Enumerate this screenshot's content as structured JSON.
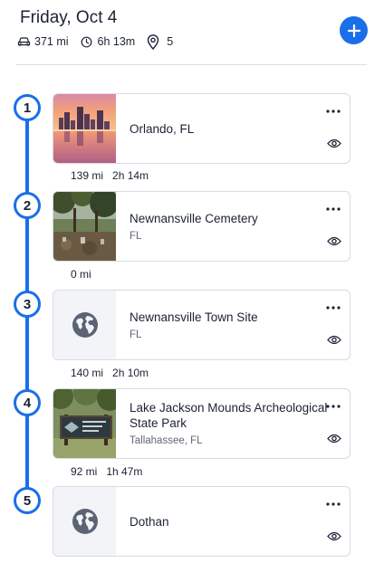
{
  "header": {
    "title": "Friday, Oct 4",
    "distance": "371 mi",
    "duration": "6h 13m",
    "stops_count": "5",
    "icons": {
      "distance": "car-icon",
      "duration": "clock-icon",
      "stops": "location-pin-icon",
      "add": "plus-icon"
    }
  },
  "colors": {
    "accent": "#1a6fe8",
    "text": "#1b2233",
    "muted": "#5f6675",
    "border": "#d7dbe1"
  },
  "stops": [
    {
      "number": "1",
      "name": "Orlando, FL",
      "subtitle": "",
      "thumbnail": "photo-city-skyline-sunset"
    },
    {
      "number": "2",
      "name": "Newnansville Cemetery",
      "subtitle": "FL",
      "thumbnail": "photo-cemetery-trees"
    },
    {
      "number": "3",
      "name": "Newnansville Town Site",
      "subtitle": "FL",
      "thumbnail": "globe-icon"
    },
    {
      "number": "4",
      "name": "Lake Jackson Mounds Archeological State Park",
      "subtitle": "Tallahassee, FL",
      "thumbnail": "photo-park-sign"
    },
    {
      "number": "5",
      "name": "Dothan",
      "subtitle": "",
      "thumbnail": "globe-icon"
    }
  ],
  "legs": [
    {
      "distance": "139 mi",
      "duration": "2h 14m"
    },
    {
      "distance": "0 mi",
      "duration": ""
    },
    {
      "distance": "140 mi",
      "duration": "2h 10m"
    },
    {
      "distance": "92 mi",
      "duration": "1h 47m"
    }
  ],
  "card_icons": {
    "more": "more-dots-icon",
    "view": "eye-icon"
  }
}
